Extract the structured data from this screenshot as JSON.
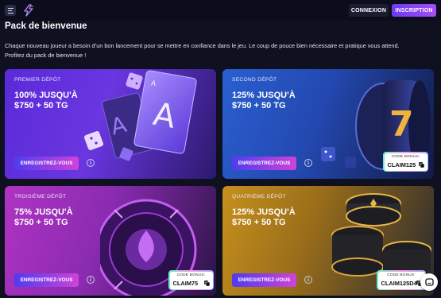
{
  "header": {
    "login_label": "CONNEXION",
    "signup_label": "INSCRIPTION"
  },
  "page": {
    "title": "Pack de bienvenue",
    "intro_line1": "Chaque nouveau joueur a besoin d’un bon lancement pour se mettre en confiance dans le jeu. Le coup de pouce bien nécessaire et pratique vous attend.",
    "intro_line2": "Profitez du pack de bienvenue !"
  },
  "cards": [
    {
      "label": "PREMIER DÉPÔT",
      "headline": "100% JUSQU'À",
      "sub": "$750 + 50 TG",
      "button": "ENREGISTREZ-VOUS",
      "has_code": false
    },
    {
      "label": "SECOND DÉPÔT",
      "headline": "125% JUSQU'À",
      "sub": "$750 + 50 TG",
      "button": "ENREGISTREZ-VOUS",
      "has_code": true,
      "code_label": "CODE BONUS:",
      "code": "CLAIM125"
    },
    {
      "label": "TROISIÈME DÉPÔT",
      "headline": "75% JUSQU'À",
      "sub": "$750 + 50 TG",
      "button": "ENREGISTREZ-VOUS",
      "has_code": true,
      "code_label": "CODE BONUS:",
      "code": "CLAIM75"
    },
    {
      "label": "QUATRIÈME DÉPÔT",
      "headline": "125% JUSQU'À",
      "sub": "$750 + 50 TG",
      "button": "ENREGISTREZ-VOUS",
      "has_code": true,
      "code_label": "CODE BONUS:",
      "code": "CLAIM125D4"
    }
  ],
  "icons": {
    "menu": "menu-icon",
    "logo": "lightning-logo",
    "info": "info-icon",
    "copy": "copy-icon",
    "chat": "chat-icon"
  },
  "colors": {
    "background": "#0f1020",
    "accent_start": "#6c3cf0",
    "accent_end": "#a54cf5",
    "register_start": "#4f3cf0",
    "register_end": "#d042d8"
  }
}
